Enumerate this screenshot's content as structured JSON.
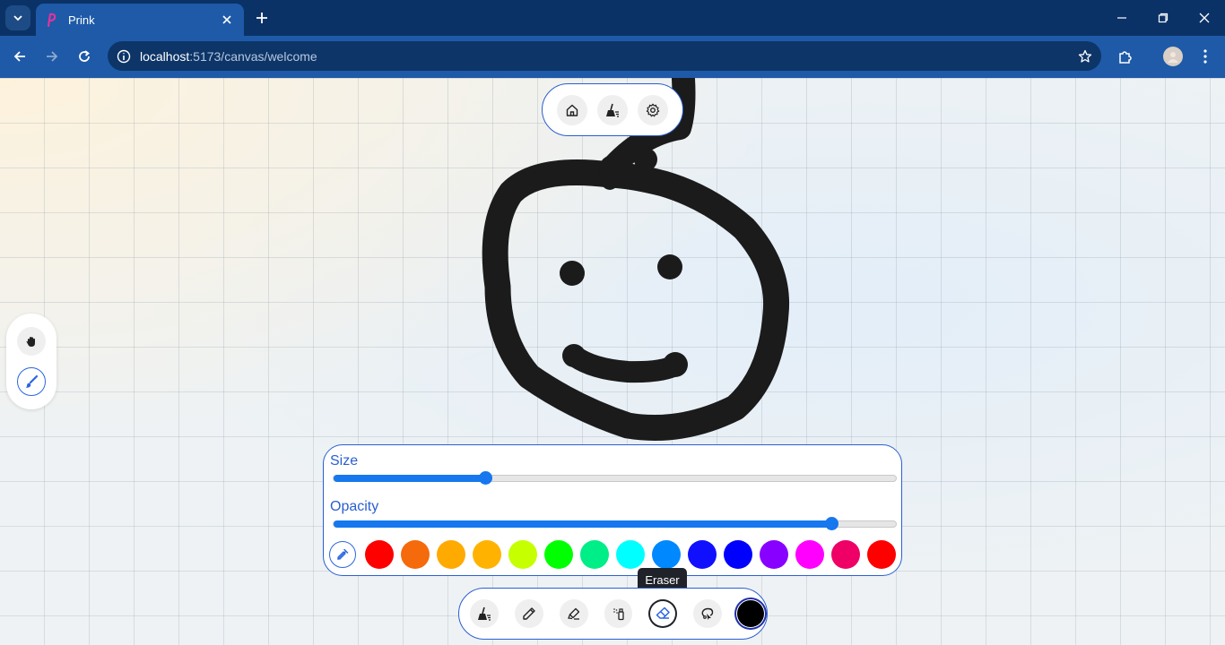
{
  "browser": {
    "tab_title": "Prink",
    "url_host": "localhost",
    "url_path": ":5173/canvas/welcome"
  },
  "icons": {
    "tab_search": "chevron-down-icon",
    "favicon": "prink-logo-icon",
    "close_tab": "close-icon",
    "new_tab": "plus-icon",
    "minimize": "minimize-icon",
    "restore": "restore-icon",
    "close_window": "close-icon",
    "back": "arrow-left-icon",
    "forward": "arrow-right-icon",
    "reload": "reload-icon",
    "site_info": "site-info-icon",
    "bookmark": "star-icon",
    "extensions": "puzzle-icon",
    "profile": "avatar-icon",
    "menu": "more-vertical-icon"
  },
  "top_menu": {
    "items": [
      "home-icon",
      "broom-icon",
      "gear-icon"
    ]
  },
  "side_tools": {
    "items": [
      "hand-icon",
      "brush-icon"
    ],
    "active": "brush-icon"
  },
  "brush_panel": {
    "size_label": "Size",
    "size_value": 0.27,
    "opacity_label": "Opacity",
    "opacity_value": 0.885,
    "colors": [
      "#ff0000",
      "#f56a0a",
      "#ffaa00",
      "#ffb300",
      "#c6ff00",
      "#00ff00",
      "#00ee88",
      "#00ffff",
      "#0088ff",
      "#1010ff",
      "#0000ff",
      "#8800ff",
      "#ff00ff",
      "#ee0066",
      "#ff0000"
    ]
  },
  "bottom_toolbar": {
    "tools": [
      "broom-icon",
      "pencil-icon",
      "highlighter-icon",
      "spray-can-icon",
      "eraser-icon",
      "lasso-icon"
    ],
    "active": "eraser-icon",
    "current_color": "#000000",
    "tooltip": "Eraser"
  },
  "accent_color": "#2b5fd0"
}
